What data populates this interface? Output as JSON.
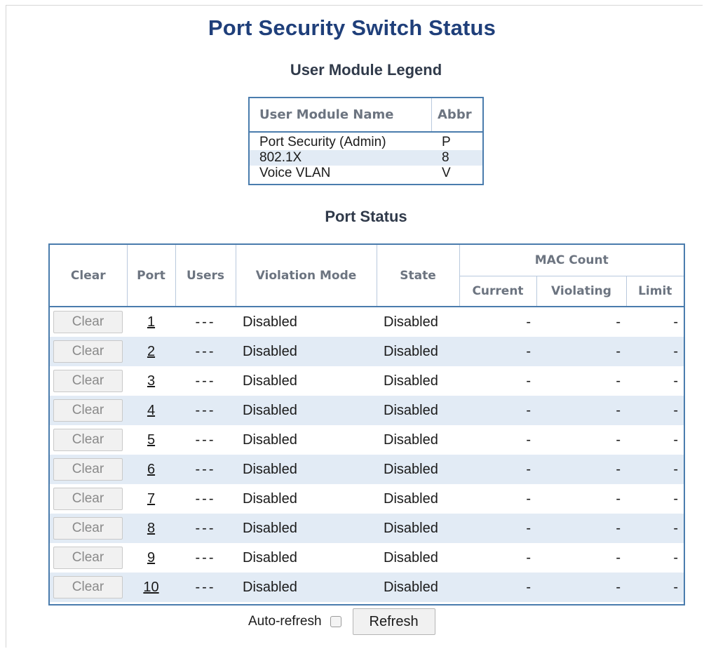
{
  "page_title": "Port Security Switch Status",
  "legend": {
    "title": "User Module Legend",
    "headers": {
      "name": "User Module Name",
      "abbr": "Abbr"
    },
    "rows": [
      {
        "name": "Port Security (Admin)",
        "abbr": "P"
      },
      {
        "name": "802.1X",
        "abbr": "8"
      },
      {
        "name": "Voice VLAN",
        "abbr": "V"
      }
    ]
  },
  "status": {
    "title": "Port Status",
    "headers": {
      "clear": "Clear",
      "port": "Port",
      "users": "Users",
      "violation_mode": "Violation Mode",
      "state": "State",
      "mac_count": "MAC Count",
      "current": "Current",
      "violating": "Violating",
      "limit": "Limit"
    },
    "rows": [
      {
        "clear": "Clear",
        "port": "1",
        "users": "---",
        "mode": "Disabled",
        "state": "Disabled",
        "current": "-",
        "violating": "-",
        "limit": "-"
      },
      {
        "clear": "Clear",
        "port": "2",
        "users": "---",
        "mode": "Disabled",
        "state": "Disabled",
        "current": "-",
        "violating": "-",
        "limit": "-"
      },
      {
        "clear": "Clear",
        "port": "3",
        "users": "---",
        "mode": "Disabled",
        "state": "Disabled",
        "current": "-",
        "violating": "-",
        "limit": "-"
      },
      {
        "clear": "Clear",
        "port": "4",
        "users": "---",
        "mode": "Disabled",
        "state": "Disabled",
        "current": "-",
        "violating": "-",
        "limit": "-"
      },
      {
        "clear": "Clear",
        "port": "5",
        "users": "---",
        "mode": "Disabled",
        "state": "Disabled",
        "current": "-",
        "violating": "-",
        "limit": "-"
      },
      {
        "clear": "Clear",
        "port": "6",
        "users": "---",
        "mode": "Disabled",
        "state": "Disabled",
        "current": "-",
        "violating": "-",
        "limit": "-"
      },
      {
        "clear": "Clear",
        "port": "7",
        "users": "---",
        "mode": "Disabled",
        "state": "Disabled",
        "current": "-",
        "violating": "-",
        "limit": "-"
      },
      {
        "clear": "Clear",
        "port": "8",
        "users": "---",
        "mode": "Disabled",
        "state": "Disabled",
        "current": "-",
        "violating": "-",
        "limit": "-"
      },
      {
        "clear": "Clear",
        "port": "9",
        "users": "---",
        "mode": "Disabled",
        "state": "Disabled",
        "current": "-",
        "violating": "-",
        "limit": "-"
      },
      {
        "clear": "Clear",
        "port": "10",
        "users": "---",
        "mode": "Disabled",
        "state": "Disabled",
        "current": "-",
        "violating": "-",
        "limit": "-"
      }
    ]
  },
  "footer": {
    "auto_refresh_label": "Auto-refresh",
    "auto_refresh_checked": false,
    "refresh_label": "Refresh"
  },
  "colors": {
    "title": "#1f3f7a",
    "table_border": "#4a7cad",
    "alt_row": "#e2ebf5",
    "header_text": "#6c7480"
  }
}
